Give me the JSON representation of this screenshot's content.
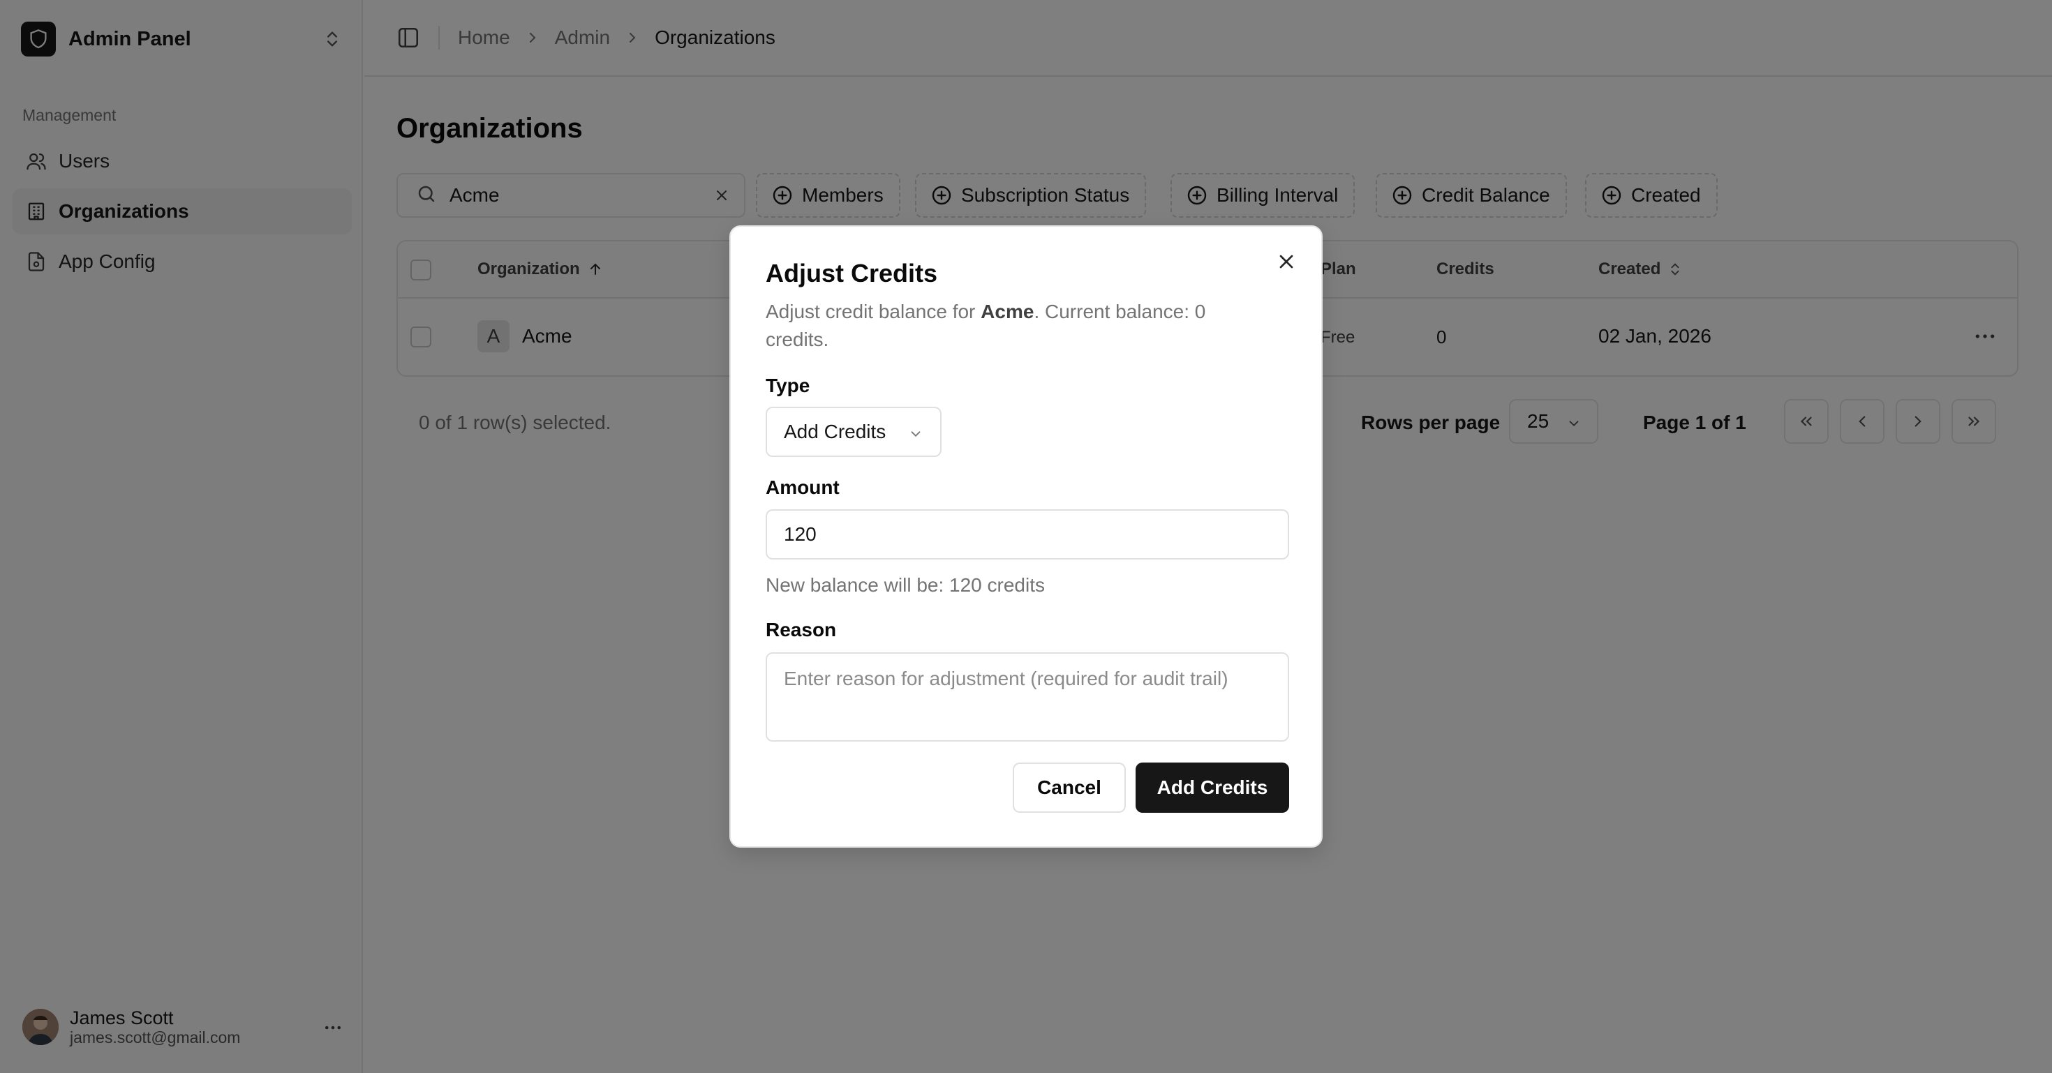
{
  "sidebar": {
    "brand_title": "Admin Panel",
    "section_label": "Management",
    "items": [
      {
        "label": "Users",
        "icon": "users-icon"
      },
      {
        "label": "Organizations",
        "icon": "building-icon",
        "active": true
      },
      {
        "label": "App Config",
        "icon": "file-settings-icon"
      }
    ],
    "user": {
      "name": "James Scott",
      "email": "james.scott@gmail.com"
    }
  },
  "breadcrumb": {
    "items": [
      "Home",
      "Admin",
      "Organizations"
    ]
  },
  "page": {
    "title": "Organizations"
  },
  "search": {
    "value": "Acme"
  },
  "filters": [
    "Members",
    "Subscription Status",
    "Billing Interval",
    "Credit Balance",
    "Created"
  ],
  "table": {
    "columns": {
      "organization": "Organization",
      "plan": "Plan",
      "credits": "Credits",
      "created": "Created"
    },
    "rows": [
      {
        "letter": "A",
        "name": "Acme",
        "plan": "Free",
        "credits": "0",
        "created": "02 Jan, 2026"
      }
    ]
  },
  "footer": {
    "selected": "0 of 1 row(s) selected.",
    "rows_per_page_label": "Rows per page",
    "rows_per_page_value": "25",
    "page_label": "Page 1 of 1"
  },
  "dialog": {
    "title": "Adjust Credits",
    "desc_prefix": "Adjust credit balance for ",
    "desc_org": "Acme",
    "desc_suffix": ". Current balance: 0 credits.",
    "type_label": "Type",
    "type_value": "Add Credits",
    "amount_label": "Amount",
    "amount_value": "120",
    "hint": "New balance will be: 120 credits",
    "reason_label": "Reason",
    "reason_placeholder": "Enter reason for adjustment (required for audit trail)",
    "cancel_label": "Cancel",
    "submit_label": "Add Credits"
  },
  "colors": {
    "primary": "#171717",
    "overlay": "rgba(0,0,0,0.5)",
    "muted_text": "#737373",
    "border": "#e5e5e5"
  }
}
